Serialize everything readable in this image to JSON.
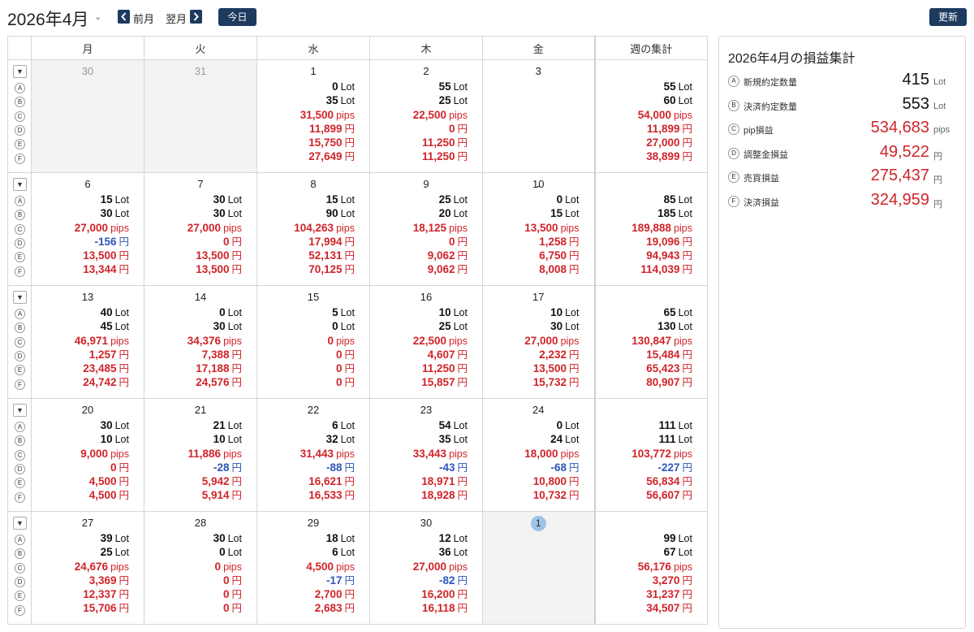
{
  "header": {
    "month_title": "2026年4月",
    "prev_label": "前月",
    "next_label": "翌月",
    "today_label": "今日",
    "refresh_label": "更新"
  },
  "calendar": {
    "weekdays": [
      "月",
      "火",
      "水",
      "木",
      "金"
    ],
    "summary_header": "週の集計",
    "row_letters": [
      "A",
      "B",
      "C",
      "D",
      "E",
      "F"
    ],
    "units": [
      "Lot",
      "Lot",
      "pips",
      "円",
      "円",
      "円"
    ],
    "colors": {
      "positive": "#d0242a",
      "negative": "#2f55b8",
      "lot": "#111111",
      "today_marker": "#9dc3e6"
    },
    "weeks": [
      {
        "days": [
          {
            "date": "30",
            "muted": true,
            "values": null
          },
          {
            "date": "31",
            "muted": true,
            "values": null
          },
          {
            "date": "1",
            "values": [
              "0",
              "35",
              "31,500",
              "11,899",
              "15,750",
              "27,649"
            ]
          },
          {
            "date": "2",
            "values": [
              "55",
              "25",
              "22,500",
              "0",
              "11,250",
              "11,250"
            ]
          },
          {
            "date": "3",
            "values": null,
            "placeholder": "-"
          }
        ],
        "summary": [
          "55",
          "60",
          "54,000",
          "11,899",
          "27,000",
          "38,899"
        ]
      },
      {
        "days": [
          {
            "date": "6",
            "values": [
              "15",
              "30",
              "27,000",
              "-156",
              "13,500",
              "13,344"
            ]
          },
          {
            "date": "7",
            "values": [
              "30",
              "30",
              "27,000",
              "0",
              "13,500",
              "13,500"
            ]
          },
          {
            "date": "8",
            "values": [
              "15",
              "90",
              "104,263",
              "17,994",
              "52,131",
              "70,125"
            ]
          },
          {
            "date": "9",
            "values": [
              "25",
              "20",
              "18,125",
              "0",
              "9,062",
              "9,062"
            ]
          },
          {
            "date": "10",
            "values": [
              "0",
              "15",
              "13,500",
              "1,258",
              "6,750",
              "8,008"
            ]
          }
        ],
        "summary": [
          "85",
          "185",
          "189,888",
          "19,096",
          "94,943",
          "114,039"
        ]
      },
      {
        "days": [
          {
            "date": "13",
            "values": [
              "40",
              "45",
              "46,971",
              "1,257",
              "23,485",
              "24,742"
            ]
          },
          {
            "date": "14",
            "values": [
              "0",
              "30",
              "34,376",
              "7,388",
              "17,188",
              "24,576"
            ]
          },
          {
            "date": "15",
            "values": [
              "5",
              "0",
              "0",
              "0",
              "0",
              "0"
            ]
          },
          {
            "date": "16",
            "values": [
              "10",
              "25",
              "22,500",
              "4,607",
              "11,250",
              "15,857"
            ]
          },
          {
            "date": "17",
            "values": [
              "10",
              "30",
              "27,000",
              "2,232",
              "13,500",
              "15,732"
            ]
          }
        ],
        "summary": [
          "65",
          "130",
          "130,847",
          "15,484",
          "65,423",
          "80,907"
        ]
      },
      {
        "days": [
          {
            "date": "20",
            "values": [
              "30",
              "10",
              "9,000",
              "0",
              "4,500",
              "4,500"
            ]
          },
          {
            "date": "21",
            "values": [
              "21",
              "10",
              "11,886",
              "-28",
              "5,942",
              "5,914"
            ]
          },
          {
            "date": "22",
            "values": [
              "6",
              "32",
              "31,443",
              "-88",
              "16,621",
              "16,533"
            ]
          },
          {
            "date": "23",
            "values": [
              "54",
              "35",
              "33,443",
              "-43",
              "18,971",
              "18,928"
            ]
          },
          {
            "date": "24",
            "values": [
              "0",
              "24",
              "18,000",
              "-68",
              "10,800",
              "10,732"
            ]
          }
        ],
        "summary": [
          "111",
          "111",
          "103,772",
          "-227",
          "56,834",
          "56,607"
        ]
      },
      {
        "days": [
          {
            "date": "27",
            "values": [
              "39",
              "25",
              "24,676",
              "3,369",
              "12,337",
              "15,706"
            ]
          },
          {
            "date": "28",
            "values": [
              "30",
              "0",
              "0",
              "0",
              "0",
              "0"
            ]
          },
          {
            "date": "29",
            "values": [
              "18",
              "6",
              "4,500",
              "-17",
              "2,700",
              "2,683"
            ]
          },
          {
            "date": "30",
            "values": [
              "12",
              "36",
              "27,000",
              "-82",
              "16,200",
              "16,118"
            ]
          },
          {
            "date": "1",
            "today": true,
            "values": null
          }
        ],
        "summary": [
          "99",
          "67",
          "56,176",
          "3,270",
          "31,237",
          "34,507"
        ]
      }
    ]
  },
  "summary_panel": {
    "title": "2026年4月の損益集計",
    "rows": [
      {
        "letter": "A",
        "label": "新規約定数量",
        "value": "415",
        "unit": "Lot",
        "color": "black"
      },
      {
        "letter": "B",
        "label": "決済約定数量",
        "value": "553",
        "unit": "Lot",
        "color": "black"
      },
      {
        "letter": "C",
        "label": "pip損益",
        "value": "534,683",
        "unit": "pips",
        "color": "red"
      },
      {
        "letter": "D",
        "label": "調整金損益",
        "value": "49,522",
        "unit": "円",
        "color": "red"
      },
      {
        "letter": "E",
        "label": "売買損益",
        "value": "275,437",
        "unit": "円",
        "color": "red"
      },
      {
        "letter": "F",
        "label": "決済損益",
        "value": "324,959",
        "unit": "円",
        "color": "red"
      }
    ]
  }
}
